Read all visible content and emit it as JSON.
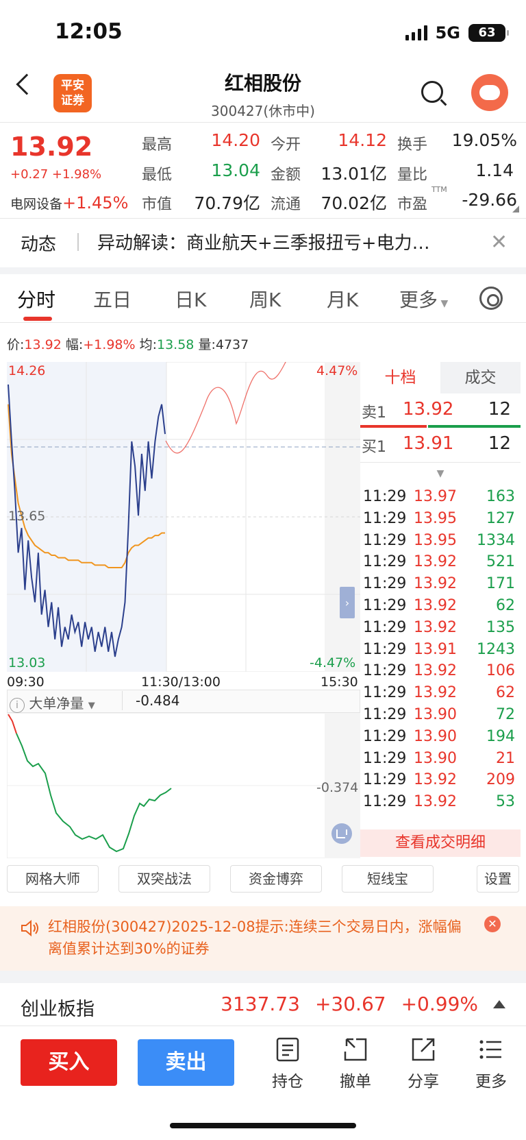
{
  "status": {
    "time": "12:05",
    "network": "5G",
    "battery": "63"
  },
  "header": {
    "logo_text": "平安\n证券",
    "title": "红相股份",
    "subtitle": "300427(休市中)"
  },
  "quote": {
    "price": "13.92",
    "change": "+0.27 +1.98%",
    "sector_name": "电网设备",
    "sector_change": "+1.45%",
    "high_label": "最高",
    "high": "14.20",
    "low_label": "最低",
    "low": "13.04",
    "mcap_label": "市值",
    "mcap": "70.79亿",
    "open_label": "今开",
    "open": "14.12",
    "amount_label": "金额",
    "amount": "13.01亿",
    "float_label": "流通",
    "float": "70.02亿",
    "turnover_label": "换手",
    "turnover": "19.05%",
    "vol_ratio_label": "量比",
    "vol_ratio": "1.14",
    "pe_label": "市盈",
    "pe_sup": "TTM",
    "pe": "-29.66"
  },
  "news": {
    "tag": "动态",
    "text": "异动解读：商业航天+三季报扭亏+电力…"
  },
  "tabs": [
    "分时",
    "五日",
    "日K",
    "周K",
    "月K",
    "更多"
  ],
  "info": {
    "price_label": "价:",
    "price": "13.92",
    "amp_label": "幅:",
    "amp": "+1.98%",
    "avg_label": "均:",
    "avg": "13.58",
    "vol_label": "量:",
    "vol": "4737"
  },
  "chart": {
    "y_top": "14.26",
    "y_mid": "13.65",
    "y_bottom": "13.03",
    "pct_top": "4.47%",
    "pct_bottom": "-4.47%",
    "x_start": "09:30",
    "x_mid": "11:30/13:00",
    "x_end": "15:30"
  },
  "chart_data": {
    "type": "line",
    "series": [
      {
        "name": "价",
        "color": "#2b3f8c",
        "values": [
          14.18,
          13.95,
          13.75,
          13.5,
          13.6,
          13.35,
          13.55,
          13.4,
          13.3,
          13.5,
          13.25,
          13.35,
          13.2,
          13.3,
          13.15,
          13.28,
          13.12,
          13.2,
          13.15,
          13.25,
          13.18,
          13.22,
          13.12,
          13.22,
          13.15,
          13.2,
          13.1,
          13.18,
          13.12,
          13.2,
          13.1,
          13.18,
          13.08,
          13.15,
          13.2,
          13.3,
          13.6,
          13.95,
          13.85,
          13.65,
          13.9,
          13.75,
          13.95,
          13.8,
          13.95,
          14.05,
          14.1,
          13.98
        ]
      },
      {
        "name": "均",
        "color": "#f0951e",
        "values": [
          14.1,
          13.9,
          13.8,
          13.7,
          13.65,
          13.6,
          13.57,
          13.55,
          13.53,
          13.52,
          13.51,
          13.5,
          13.5,
          13.49,
          13.49,
          13.48,
          13.48,
          13.48,
          13.47,
          13.47,
          13.47,
          13.47,
          13.46,
          13.46,
          13.46,
          13.46,
          13.45,
          13.45,
          13.45,
          13.45,
          13.44,
          13.44,
          13.44,
          13.44,
          13.44,
          13.46,
          13.5,
          13.52,
          13.53,
          13.53,
          13.54,
          13.55,
          13.56,
          13.56,
          13.57,
          13.57,
          13.58,
          13.58
        ]
      }
    ],
    "ylim": [
      13.03,
      14.26
    ],
    "prev_close": 13.65
  },
  "order_book": {
    "tab_ten": "十档",
    "tab_trades": "成交",
    "sell1_label": "卖1",
    "sell1_price": "13.92",
    "sell1_vol": "12",
    "buy1_label": "买1",
    "buy1_price": "13.91",
    "buy1_vol": "12"
  },
  "trades": [
    {
      "time": "11:29",
      "price": "13.97",
      "vol": "163",
      "dir": "buy"
    },
    {
      "time": "11:29",
      "price": "13.95",
      "vol": "127",
      "dir": "buy"
    },
    {
      "time": "11:29",
      "price": "13.95",
      "vol": "1334",
      "dir": "buy"
    },
    {
      "time": "11:29",
      "price": "13.92",
      "vol": "521",
      "dir": "buy"
    },
    {
      "time": "11:29",
      "price": "13.92",
      "vol": "171",
      "dir": "buy"
    },
    {
      "time": "11:29",
      "price": "13.92",
      "vol": "62",
      "dir": "buy"
    },
    {
      "time": "11:29",
      "price": "13.92",
      "vol": "135",
      "dir": "buy"
    },
    {
      "time": "11:29",
      "price": "13.91",
      "vol": "1243",
      "dir": "buy"
    },
    {
      "time": "11:29",
      "price": "13.92",
      "vol": "106",
      "dir": "sell"
    },
    {
      "time": "11:29",
      "price": "13.92",
      "vol": "62",
      "dir": "sell"
    },
    {
      "time": "11:29",
      "price": "13.90",
      "vol": "72",
      "dir": "buy"
    },
    {
      "time": "11:29",
      "price": "13.90",
      "vol": "194",
      "dir": "buy"
    },
    {
      "time": "11:29",
      "price": "13.90",
      "vol": "21",
      "dir": "sell"
    },
    {
      "time": "11:29",
      "price": "13.92",
      "vol": "209",
      "dir": "sell"
    },
    {
      "time": "11:29",
      "price": "13.92",
      "vol": "53",
      "dir": "buy"
    }
  ],
  "trade_detail_label": "查看成交明细",
  "flow": {
    "label": "大单净量",
    "value": "-0.484",
    "axis_label": "-0.374"
  },
  "tools": [
    "网格大师",
    "双突战法",
    "资金博弈",
    "短线宝",
    "设置"
  ],
  "notice": {
    "text": "红相股份(300427)2025-12-08提示:连续三个交易日内，涨幅偏离值累计达到30%的证券"
  },
  "index": {
    "name": "创业板指",
    "value": "3137.73",
    "change": "+30.67",
    "pct": "+0.99%"
  },
  "bottom": {
    "buy": "买入",
    "sell": "卖出",
    "hold": "持仓",
    "cancel": "撤单",
    "share": "分享",
    "more": "更多"
  },
  "colors": {
    "up": "#e8352b",
    "down": "#1a9e4b",
    "price_line": "#2b3f8c",
    "avg_line": "#f0951e",
    "buy_btn": "#e8231e",
    "sell_btn": "#3b8df7"
  }
}
